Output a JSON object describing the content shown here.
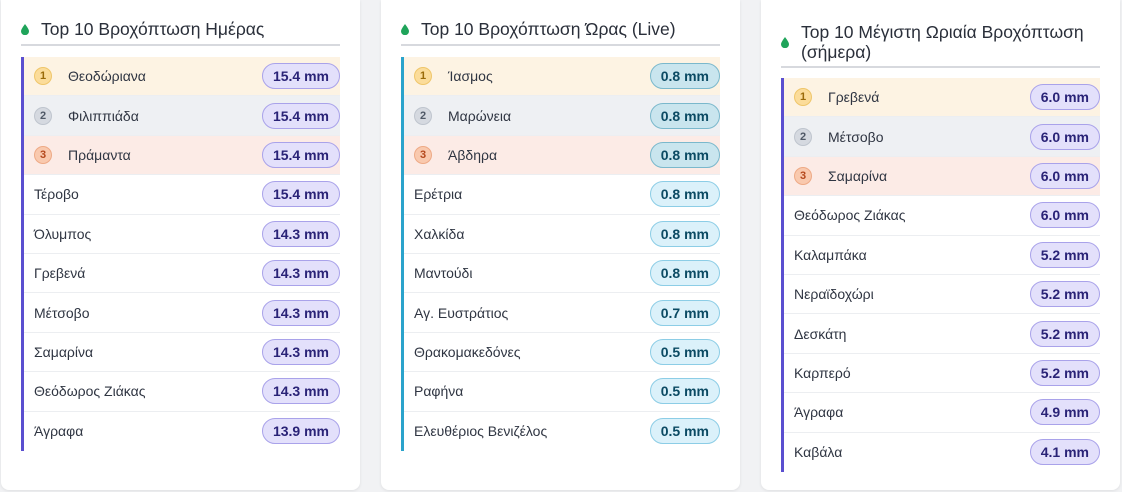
{
  "panels": [
    {
      "title": "Top 10 Βροχόπτωση Ημέρας",
      "rows": [
        {
          "rank": "1",
          "name": "Θεοδώριανα",
          "value": "15.4 mm"
        },
        {
          "rank": "2",
          "name": "Φιλιππιάδα",
          "value": "15.4 mm"
        },
        {
          "rank": "3",
          "name": "Πράμαντα",
          "value": "15.4 mm"
        },
        {
          "rank": "",
          "name": "Τέροβο",
          "value": "15.4 mm"
        },
        {
          "rank": "",
          "name": "Όλυμπος",
          "value": "14.3 mm"
        },
        {
          "rank": "",
          "name": "Γρεβενά",
          "value": "14.3 mm"
        },
        {
          "rank": "",
          "name": "Μέτσοβο",
          "value": "14.3 mm"
        },
        {
          "rank": "",
          "name": "Σαμαρίνα",
          "value": "14.3 mm"
        },
        {
          "rank": "",
          "name": "Θεόδωρος Ζιάκας",
          "value": "14.3 mm"
        },
        {
          "rank": "",
          "name": "Άγραφα",
          "value": "13.9 mm"
        }
      ]
    },
    {
      "title": "Top 10 Βροχόπτωση Ώρας (Live)",
      "rows": [
        {
          "rank": "1",
          "name": "Ίασμος",
          "value": "0.8 mm"
        },
        {
          "rank": "2",
          "name": "Μαρώνεια",
          "value": "0.8 mm"
        },
        {
          "rank": "3",
          "name": "Άβδηρα",
          "value": "0.8 mm"
        },
        {
          "rank": "",
          "name": "Ερέτρια",
          "value": "0.8 mm"
        },
        {
          "rank": "",
          "name": "Χαλκίδα",
          "value": "0.8 mm"
        },
        {
          "rank": "",
          "name": "Μαντούδι",
          "value": "0.8 mm"
        },
        {
          "rank": "",
          "name": "Αγ. Ευστράτιος",
          "value": "0.7 mm"
        },
        {
          "rank": "",
          "name": "Θρακομακεδόνες",
          "value": "0.5 mm"
        },
        {
          "rank": "",
          "name": "Ραφήνα",
          "value": "0.5 mm"
        },
        {
          "rank": "",
          "name": "Ελευθέριος Βενιζέλος",
          "value": "0.5 mm"
        }
      ]
    },
    {
      "title": "Top 10 Μέγιστη Ωριαία Βροχόπτωση (σήμερα)",
      "rows": [
        {
          "rank": "1",
          "name": "Γρεβενά",
          "value": "6.0 mm"
        },
        {
          "rank": "2",
          "name": "Μέτσοβο",
          "value": "6.0 mm"
        },
        {
          "rank": "3",
          "name": "Σαμαρίνα",
          "value": "6.0 mm"
        },
        {
          "rank": "",
          "name": "Θεόδωρος Ζιάκας",
          "value": "6.0 mm"
        },
        {
          "rank": "",
          "name": "Καλαμπάκα",
          "value": "5.2 mm"
        },
        {
          "rank": "",
          "name": "Νεραϊδοχώρι",
          "value": "5.2 mm"
        },
        {
          "rank": "",
          "name": "Δεσκάτη",
          "value": "5.2 mm"
        },
        {
          "rank": "",
          "name": "Καρπερό",
          "value": "5.2 mm"
        },
        {
          "rank": "",
          "name": "Άγραφα",
          "value": "4.9 mm"
        },
        {
          "rank": "",
          "name": "Καβάλα",
          "value": "4.1 mm"
        }
      ]
    }
  ],
  "icons": {
    "header": "raindrop-icon"
  },
  "colors": {
    "drop": "#1fa45a",
    "accent_purple": "#5a4fd0",
    "accent_teal": "#2aa3cc"
  }
}
